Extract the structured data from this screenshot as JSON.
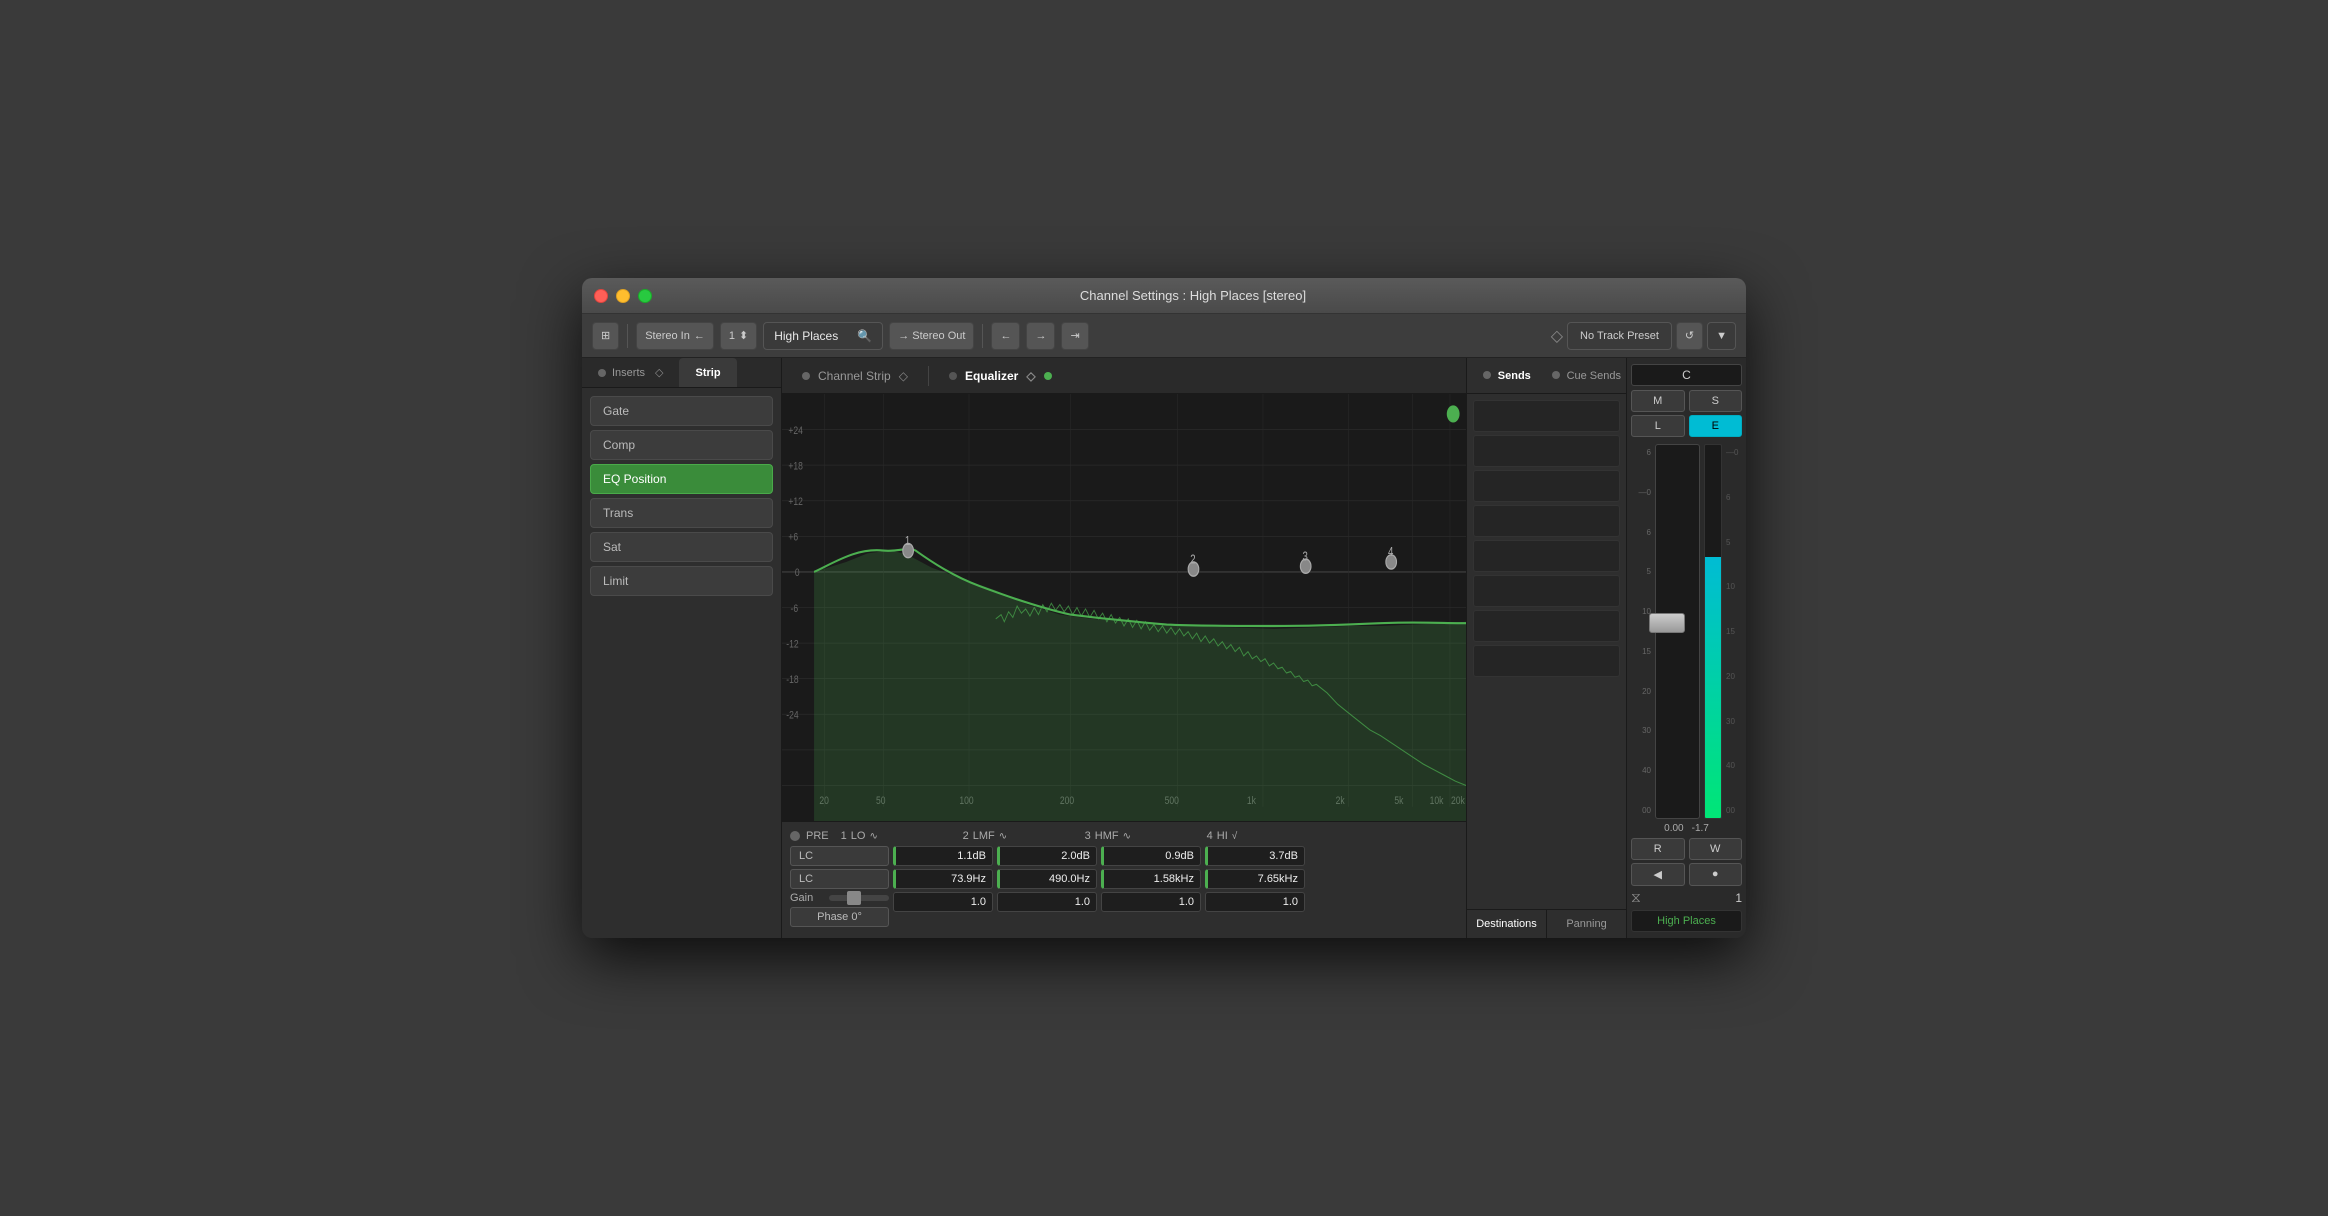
{
  "window": {
    "title": "Channel Settings : High Places [stereo]"
  },
  "toolbar": {
    "input_label": "Stereo In",
    "channel_num": "1",
    "channel_name": "High Places",
    "output_label": "→ Stereo Out",
    "preset_label": "No Track Preset",
    "back_arrow": "←",
    "forward_arrow": "→",
    "route_icon": "⇥"
  },
  "inserts_panel": {
    "inserts_tab": "Inserts",
    "strip_tab": "Strip",
    "items": [
      {
        "label": "Gate",
        "active": false
      },
      {
        "label": "Comp",
        "active": false
      },
      {
        "label": "EQ Position",
        "active": true
      },
      {
        "label": "Trans",
        "active": false
      },
      {
        "label": "Sat",
        "active": false
      },
      {
        "label": "Limit",
        "active": false
      }
    ]
  },
  "channel_strip": {
    "tab_label": "Channel Strip"
  },
  "equalizer": {
    "tab_label": "Equalizer",
    "freq_labels": [
      "20",
      "50",
      "100",
      "200",
      "500",
      "1k",
      "2k",
      "5k",
      "10k",
      "20k"
    ],
    "db_labels": [
      "+24",
      "+18",
      "+12",
      "+6",
      "0",
      "-6",
      "-12",
      "-18",
      "-24"
    ],
    "pre_label": "PRE",
    "bands": [
      {
        "num": "1",
        "type": "LO",
        "icon": "∿",
        "lc_label": "LC",
        "gain_value": "1.1dB",
        "freq_value": "73.9Hz",
        "q_value": "1.0"
      },
      {
        "num": "2",
        "type": "LMF",
        "icon": "∿",
        "gain_value": "2.0dB",
        "freq_value": "490.0Hz",
        "q_value": "1.0"
      },
      {
        "num": "3",
        "type": "HMF",
        "icon": "∿",
        "gain_value": "0.9dB",
        "freq_value": "1.58kHz",
        "q_value": "1.0"
      },
      {
        "num": "4",
        "type": "HI",
        "icon": "√",
        "gain_value": "3.7dB",
        "freq_value": "7.65kHz",
        "q_value": "1.0"
      }
    ],
    "gain_label": "Gain",
    "phase_label": "Phase 0°",
    "lc2_label": "LC"
  },
  "sends": {
    "sends_tab": "Sends",
    "cue_sends_tab": "Cue Sends",
    "slots": 8,
    "destinations_btn": "Destinations",
    "panning_btn": "Panning"
  },
  "mixer": {
    "center_label": "C",
    "m_btn": "M",
    "s_btn": "S",
    "l_btn": "L",
    "e_btn": "E",
    "r_btn": "R",
    "w_btn": "W",
    "play_btn": "◀",
    "rec_btn": "●",
    "fader_value": "0.00",
    "meter_value": "-1.7",
    "link_num": "1",
    "channel_name": "High Places",
    "scale": [
      "6",
      "0",
      "6",
      "5",
      "10",
      "15",
      "20",
      "30",
      "40",
      "00"
    ]
  }
}
